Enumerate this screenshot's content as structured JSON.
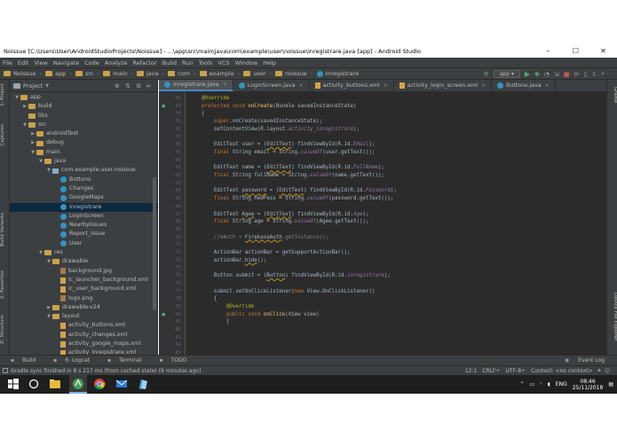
{
  "window": {
    "title": "Noissue [C:\\Users\\User\\AndroidStudioProjects\\Noissue] - ...\\app\\src\\main\\java\\com\\example\\user\\noissue\\Inregistrare.java [app] - Android Studio",
    "minimize": "–",
    "maximize": "☐",
    "close": "✕"
  },
  "menu": [
    "File",
    "Edit",
    "View",
    "Navigate",
    "Code",
    "Analyze",
    "Refactor",
    "Build",
    "Run",
    "Tools",
    "VCS",
    "Window",
    "Help"
  ],
  "breadcrumbs": [
    "Noissue",
    "app",
    "src",
    "main",
    "java",
    "com",
    "example",
    "user",
    "noissue",
    "Inregistrare"
  ],
  "run_config": "app",
  "project_panel": {
    "title": "Project",
    "tree": [
      {
        "indent": 0,
        "arrow": "▼",
        "icon": "folder",
        "label": "app"
      },
      {
        "indent": 1,
        "arrow": "▶",
        "icon": "folder",
        "label": "build"
      },
      {
        "indent": 1,
        "arrow": "",
        "icon": "folder",
        "label": "libs"
      },
      {
        "indent": 1,
        "arrow": "▼",
        "icon": "folder",
        "label": "src"
      },
      {
        "indent": 2,
        "arrow": "▶",
        "icon": "folder",
        "label": "androidTest"
      },
      {
        "indent": 2,
        "arrow": "▶",
        "icon": "folder",
        "label": "debug"
      },
      {
        "indent": 2,
        "arrow": "▼",
        "icon": "folder",
        "label": "main"
      },
      {
        "indent": 3,
        "arrow": "▼",
        "icon": "folder",
        "label": "java"
      },
      {
        "indent": 4,
        "arrow": "▼",
        "icon": "package",
        "label": "com.example.user.noissue"
      },
      {
        "indent": 5,
        "arrow": "",
        "icon": "class",
        "label": "Buttons"
      },
      {
        "indent": 5,
        "arrow": "",
        "icon": "class",
        "label": "Changes"
      },
      {
        "indent": 5,
        "arrow": "",
        "icon": "class",
        "label": "GoogleMaps"
      },
      {
        "indent": 5,
        "arrow": "",
        "icon": "class",
        "label": "Inregistrare",
        "selected": true
      },
      {
        "indent": 5,
        "arrow": "",
        "icon": "class",
        "label": "LoginScreen"
      },
      {
        "indent": 5,
        "arrow": "",
        "icon": "class",
        "label": "NearbyIssues"
      },
      {
        "indent": 5,
        "arrow": "",
        "icon": "class",
        "label": "Report_issue"
      },
      {
        "indent": 5,
        "arrow": "",
        "icon": "class",
        "label": "User"
      },
      {
        "indent": 3,
        "arrow": "▼",
        "icon": "folder",
        "label": "res"
      },
      {
        "indent": 4,
        "arrow": "▼",
        "icon": "folder",
        "label": "drawable"
      },
      {
        "indent": 5,
        "arrow": "",
        "icon": "image",
        "label": "background.jpg"
      },
      {
        "indent": 5,
        "arrow": "",
        "icon": "xml",
        "label": "ic_launcher_background.xml"
      },
      {
        "indent": 5,
        "arrow": "",
        "icon": "xml",
        "label": "ic_user_background.xml"
      },
      {
        "indent": 5,
        "arrow": "",
        "icon": "image",
        "label": "logo.png"
      },
      {
        "indent": 4,
        "arrow": "▶",
        "icon": "folder",
        "label": "drawable-v24"
      },
      {
        "indent": 4,
        "arrow": "▼",
        "icon": "folder",
        "label": "layout"
      },
      {
        "indent": 5,
        "arrow": "",
        "icon": "xml",
        "label": "activity_buttons.xml"
      },
      {
        "indent": 5,
        "arrow": "",
        "icon": "xml",
        "label": "activity_changes.xml"
      },
      {
        "indent": 5,
        "arrow": "",
        "icon": "xml",
        "label": "activity_google_maps.xml"
      },
      {
        "indent": 5,
        "arrow": "",
        "icon": "xml",
        "label": "activity_inregistrare.xml"
      }
    ]
  },
  "left_tool_tabs": [
    "1: Project",
    "Captures",
    "Build Variants",
    "2: Favorites",
    "Z: Structure"
  ],
  "right_tool_tabs": [
    "Gradle",
    "Device File Explorer"
  ],
  "editor_tabs": [
    {
      "label": "Inregistrare.java",
      "icon": "class",
      "active": true
    },
    {
      "label": "LoginScreen.java",
      "icon": "class",
      "active": false
    },
    {
      "label": "activity_buttons.xml",
      "icon": "xml",
      "active": false
    },
    {
      "label": "activity_login_screen.xml",
      "icon": "xml",
      "active": false
    },
    {
      "label": "Buttons.java",
      "icon": "class",
      "active": false
    }
  ],
  "line_numbers": [
    "52",
    "53",
    "54",
    "55",
    "56",
    "57",
    "58",
    "59",
    "60",
    "61",
    "62",
    "63",
    "64",
    "65",
    "66",
    "67",
    "68",
    "69",
    "70",
    "71",
    "72",
    "73",
    "74",
    "75",
    "76",
    "77",
    "78",
    "79",
    "80",
    "81",
    "82",
    "83",
    "84",
    "85"
  ],
  "code_lines": [
    [
      {
        "c": "ann",
        "t": "    @Override"
      }
    ],
    [
      {
        "c": "kw",
        "t": "    protected void "
      },
      {
        "c": "fn",
        "t": "onCreate"
      },
      {
        "c": "",
        "t": "(Bundle savedInstanceState)"
      }
    ],
    [
      {
        "c": "",
        "t": "    {"
      }
    ],
    [
      {
        "c": "kw",
        "t": "        super"
      },
      {
        "c": "",
        "t": ".onCreate(savedInstanceState);"
      }
    ],
    [
      {
        "c": "",
        "t": "        setContentView(R.layout."
      },
      {
        "c": "fld",
        "t": "activity_inregistrare"
      },
      {
        "c": "",
        "t": ");"
      }
    ],
    [
      {
        "c": "",
        "t": ""
      }
    ],
    [
      {
        "c": "",
        "t": "        EditText user = ("
      },
      {
        "c": "warn",
        "t": "EditText"
      },
      {
        "c": "",
        "t": ") findViewById(R.id."
      },
      {
        "c": "fld",
        "t": "Email"
      },
      {
        "c": "",
        "t": ");"
      }
    ],
    [
      {
        "c": "kw",
        "t": "        final "
      },
      {
        "c": "",
        "t": "String email = String."
      },
      {
        "c": "fld",
        "t": "valueOf"
      },
      {
        "c": "",
        "t": "(user.getText());"
      }
    ],
    [
      {
        "c": "",
        "t": ""
      }
    ],
    [
      {
        "c": "",
        "t": "        EditText name = ("
      },
      {
        "c": "warn",
        "t": "EditText"
      },
      {
        "c": "",
        "t": ") findViewById(R.id."
      },
      {
        "c": "fld",
        "t": "FullName"
      },
      {
        "c": "",
        "t": ");"
      }
    ],
    [
      {
        "c": "kw",
        "t": "        final "
      },
      {
        "c": "",
        "t": "String fullName = String."
      },
      {
        "c": "fld",
        "t": "valueOf"
      },
      {
        "c": "",
        "t": "(name.getText());"
      }
    ],
    [
      {
        "c": "",
        "t": ""
      }
    ],
    [
      {
        "c": "",
        "t": "        EditText "
      },
      {
        "c": "warn",
        "t": "password"
      },
      {
        "c": "",
        "t": " = ("
      },
      {
        "c": "warn",
        "t": "EditText"
      },
      {
        "c": "",
        "t": ") findViewById(R.id."
      },
      {
        "c": "fld",
        "t": "Password"
      },
      {
        "c": "",
        "t": ");"
      }
    ],
    [
      {
        "c": "kw",
        "t": "        final "
      },
      {
        "c": "",
        "t": "String newPass = String."
      },
      {
        "c": "fld",
        "t": "valueOf"
      },
      {
        "c": "",
        "t": "(password.getText());"
      }
    ],
    [
      {
        "c": "",
        "t": ""
      }
    ],
    [
      {
        "c": "",
        "t": "        EditText "
      },
      {
        "c": "warn",
        "t": "Agee"
      },
      {
        "c": "",
        "t": " = ("
      },
      {
        "c": "warn",
        "t": "EditText"
      },
      {
        "c": "",
        "t": ") findViewById(R.id."
      },
      {
        "c": "fld",
        "t": "Age"
      },
      {
        "c": "",
        "t": ");"
      }
    ],
    [
      {
        "c": "kw",
        "t": "        final "
      },
      {
        "c": "",
        "t": "String age = String."
      },
      {
        "c": "fld",
        "t": "valueOf"
      },
      {
        "c": "",
        "t": "(Agee.getText());"
      }
    ],
    [
      {
        "c": "",
        "t": ""
      }
    ],
    [
      {
        "c": "cm",
        "t": "        //mAuth = "
      },
      {
        "c": "warn",
        "t": "FirebaseAuth"
      },
      {
        "c": "cm",
        "t": ".getInstance();"
      }
    ],
    [
      {
        "c": "",
        "t": ""
      }
    ],
    [
      {
        "c": "",
        "t": "        ActionBar actionBar = getSupportActionBar();"
      }
    ],
    [
      {
        "c": "",
        "t": "        actionBar."
      },
      {
        "c": "warn",
        "t": "hide"
      },
      {
        "c": "",
        "t": "();"
      }
    ],
    [
      {
        "c": "",
        "t": ""
      }
    ],
    [
      {
        "c": "",
        "t": "        Button submit = ("
      },
      {
        "c": "warn",
        "t": "Button"
      },
      {
        "c": "",
        "t": ") findViewById(R.id."
      },
      {
        "c": "fld",
        "t": "inregistrare"
      },
      {
        "c": "",
        "t": ");"
      }
    ],
    [
      {
        "c": "",
        "t": ""
      }
    ],
    [
      {
        "c": "",
        "t": "        submit.setOnClickListener("
      },
      {
        "c": "kw",
        "t": "new "
      },
      {
        "c": "",
        "t": "View.OnClickListener()"
      }
    ],
    [
      {
        "c": "",
        "t": "        {"
      }
    ],
    [
      {
        "c": "ann",
        "t": "            @Override"
      }
    ],
    [
      {
        "c": "kw",
        "t": "            public void "
      },
      {
        "c": "fn",
        "t": "onClick"
      },
      {
        "c": "",
        "t": "(View view)"
      }
    ],
    [
      {
        "c": "",
        "t": "            {"
      }
    ],
    [
      {
        "c": "",
        "t": ""
      }
    ],
    [
      {
        "c": "",
        "t": ""
      }
    ],
    [
      {
        "c": "",
        "t": ""
      }
    ],
    [
      {
        "c": "",
        "t": ""
      }
    ]
  ],
  "bottom_tools": [
    {
      "icon": "hammer-icon",
      "label": "Build"
    },
    {
      "icon": "logcat-icon",
      "label": "6: Logcat"
    },
    {
      "icon": "terminal-icon",
      "label": "Terminal"
    },
    {
      "icon": "todo-icon",
      "label": "TODO"
    }
  ],
  "event_log": "Event Log",
  "status": {
    "message": "Gradle sync finished in 8 s 217 ms (from cached state) (9 minutes ago)",
    "position": "12:1",
    "line_sep": "CRLF÷",
    "encoding": "UTF-8÷",
    "context": "Context: <no context>"
  },
  "taskbar": {
    "lang": "ENG",
    "time": "08:46",
    "date": "25/11/2018"
  },
  "colors": {
    "bg_editor": "#2b2b2b",
    "bg_panel": "#3c3f41",
    "selection": "#0d293e",
    "accent": "#4a88c7"
  }
}
